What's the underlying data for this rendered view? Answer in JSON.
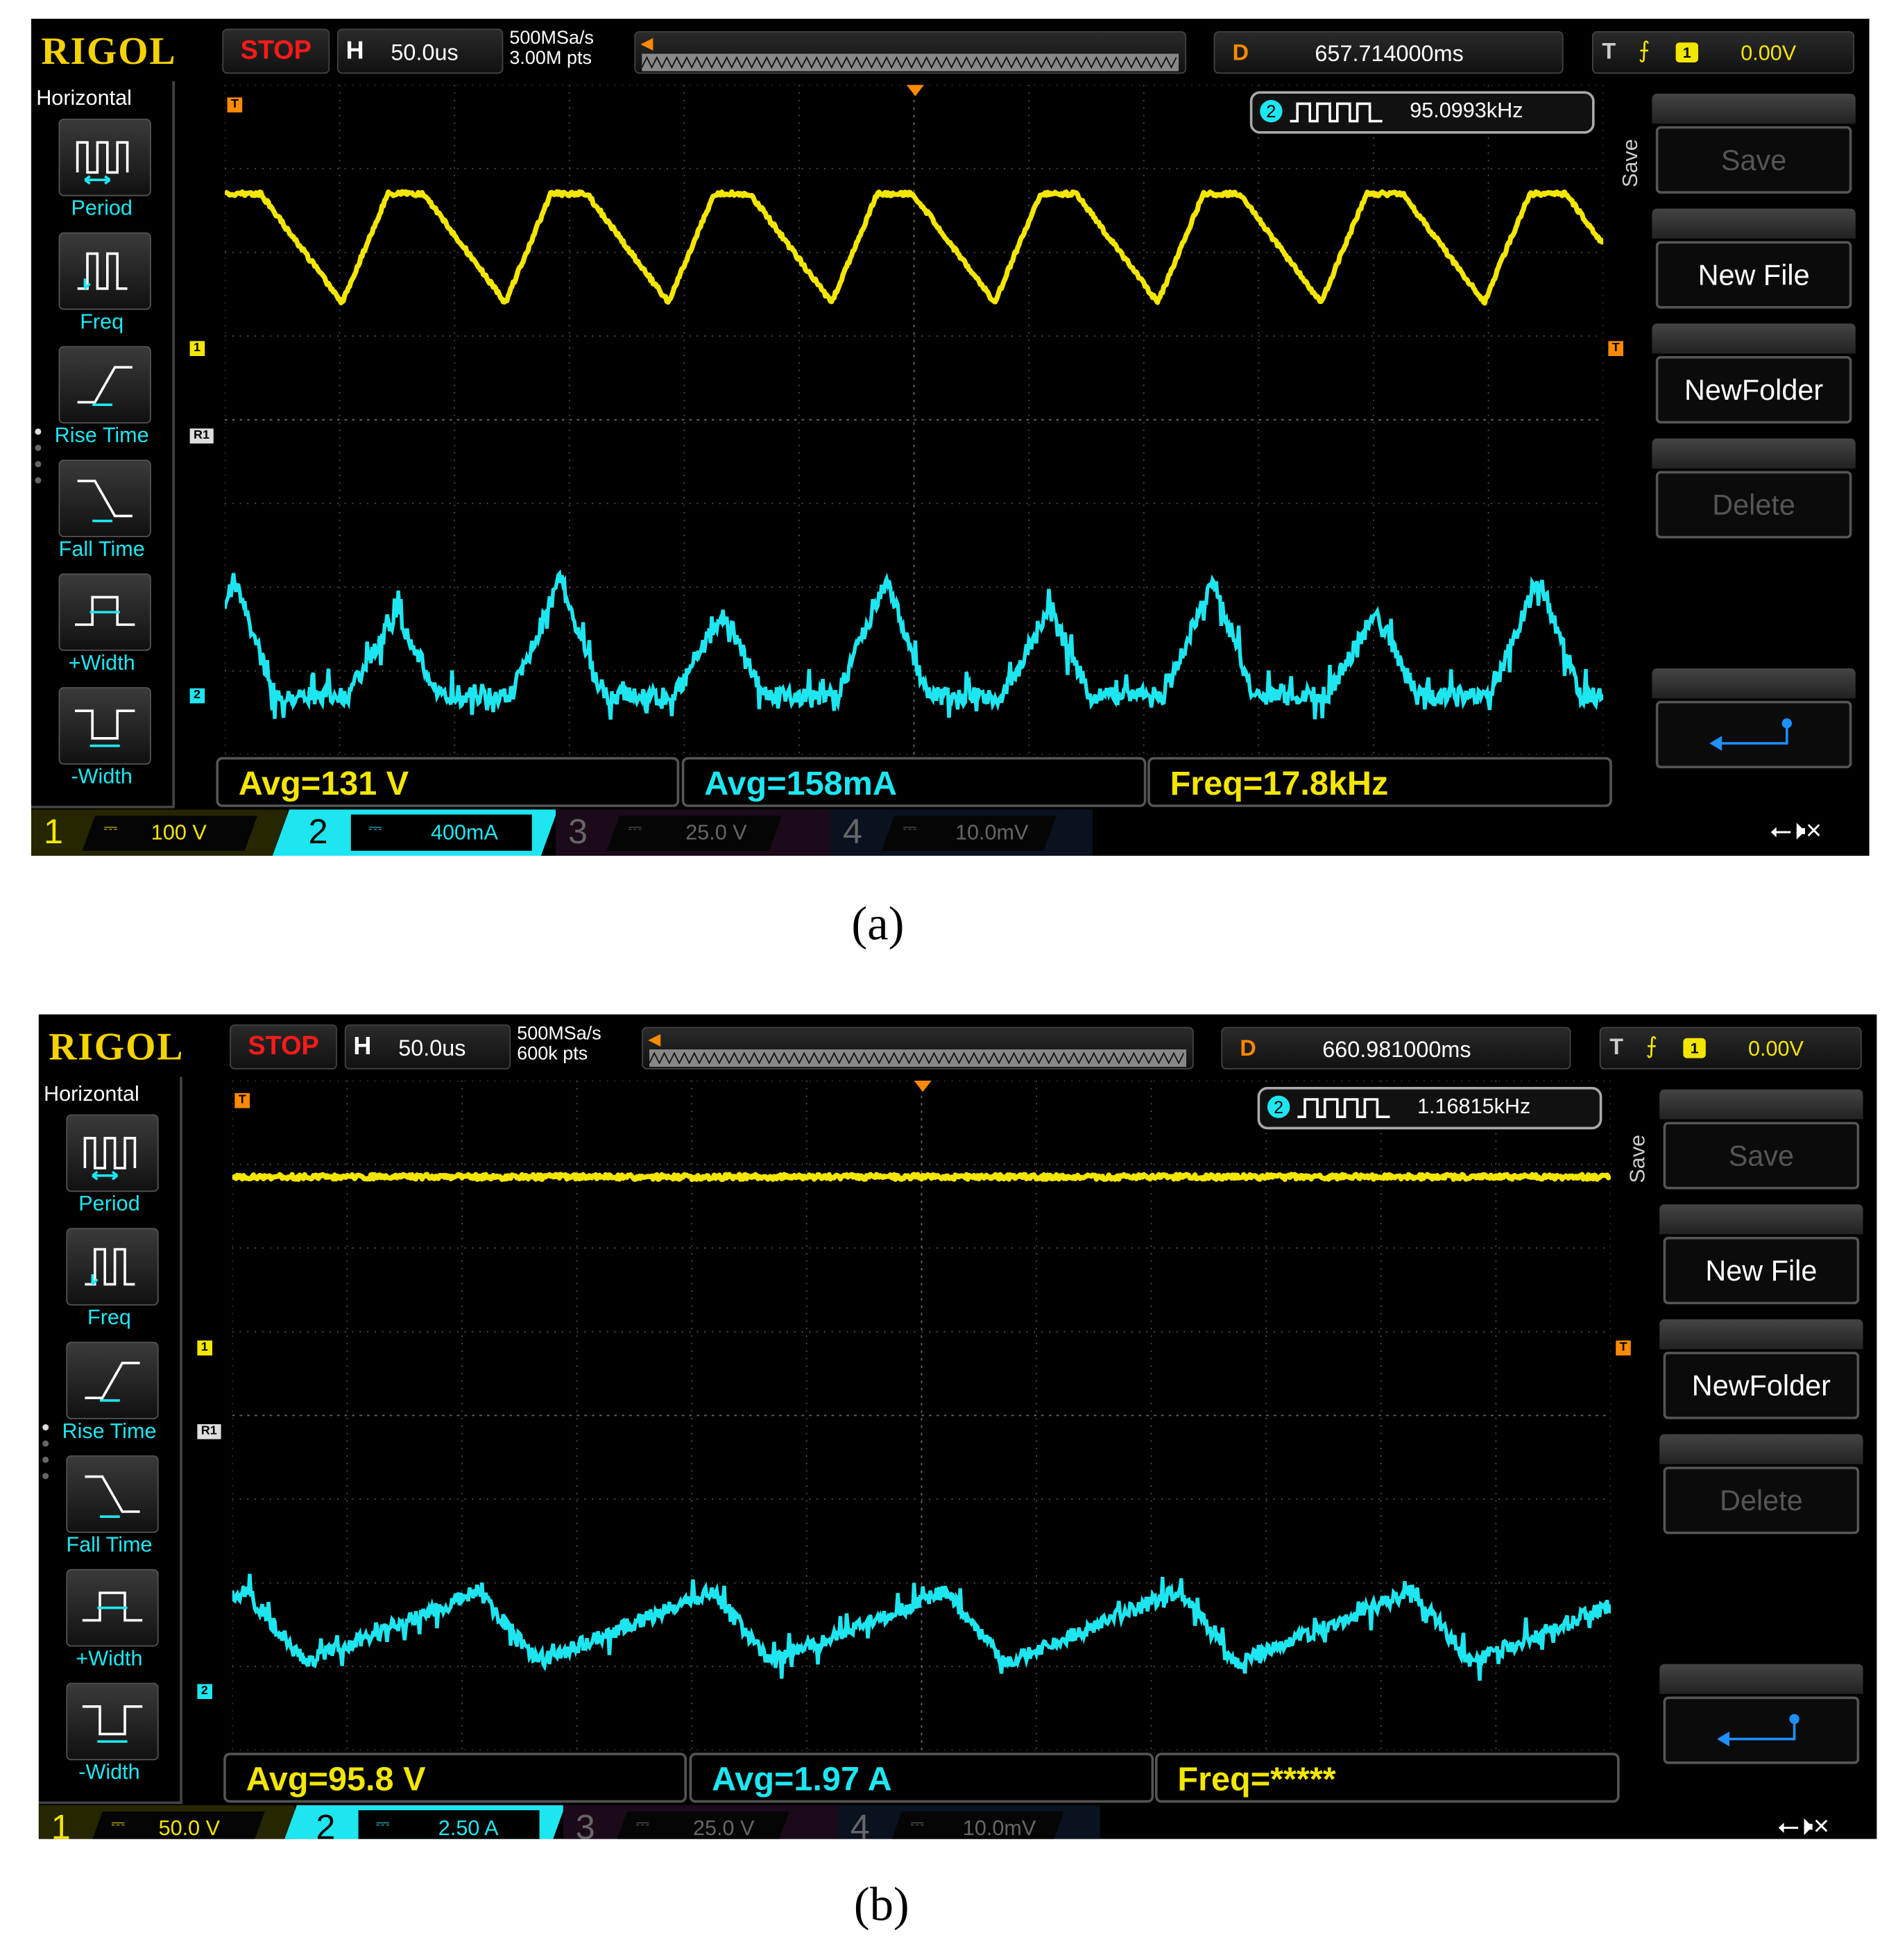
{
  "figure": {
    "captions": [
      "(a)",
      "(b)"
    ]
  },
  "panels": [
    {
      "logo": "RIGOL",
      "run_state": "STOP",
      "horizontal": {
        "key": "H",
        "timebase": "50.0us"
      },
      "sample_rate": "500MSa/s",
      "memory_depth": "3.00M pts",
      "delay": {
        "key": "D",
        "value": "657.714000ms"
      },
      "trigger": {
        "key": "T",
        "edge_icon": "rising-edge-icon",
        "source": "1",
        "level": "0.00V"
      },
      "sidebar": {
        "title": "Horizontal",
        "items": [
          "Period",
          "Freq",
          "Rise Time",
          "Fall Time",
          "+Width",
          "-Width"
        ]
      },
      "counter": {
        "channel": "2",
        "value": "95.0993kHz"
      },
      "markers": {
        "trig": "T",
        "ch1": "1",
        "ref": "R1",
        "ch2": "2"
      },
      "save_menu": {
        "title": "Save",
        "buttons": [
          "Save",
          "New File",
          "NewFolder",
          "Delete"
        ],
        "return_icon": "return-arrow-icon",
        "enabled": [
          false,
          true,
          true,
          false
        ]
      },
      "measurements": [
        {
          "text": "Avg=131 V",
          "color": "#f3e600"
        },
        {
          "text": "Avg=158mA",
          "color": "#1ee6f0"
        },
        {
          "text": "Freq=17.8kHz",
          "color": "#f3e600"
        }
      ],
      "channels": [
        {
          "num": "1",
          "coupling": "⎓",
          "scale": "100 V"
        },
        {
          "num": "2",
          "coupling": "⎓",
          "scale": "400mA"
        },
        {
          "num": "3",
          "coupling": "⎓",
          "scale": "25.0 V"
        },
        {
          "num": "4",
          "coupling": "⎓",
          "scale": "10.0mV"
        }
      ],
      "status_icons": [
        "usb-icon",
        "speaker-mute-icon"
      ],
      "waveforms": {
        "ch1": {
          "shape": "trapezoid-sawtooth",
          "period_div": 1.42,
          "high_div": 1.3,
          "low_div": 2.6
        },
        "ch2": {
          "shape": "alternating-triangle-pulses",
          "period_div": 1.42,
          "base_div": 7.3,
          "peak_div": [
            5.9,
            6.3
          ]
        },
        "marker_div": {
          "ch1": 3.15,
          "ref": 4.2,
          "ch2": 7.3,
          "trig": 3.15
        }
      }
    },
    {
      "logo": "RIGOL",
      "run_state": "STOP",
      "horizontal": {
        "key": "H",
        "timebase": "50.0us"
      },
      "sample_rate": "500MSa/s",
      "memory_depth": "600k pts",
      "delay": {
        "key": "D",
        "value": "660.981000ms"
      },
      "trigger": {
        "key": "T",
        "edge_icon": "rising-edge-icon",
        "source": "1",
        "level": "0.00V"
      },
      "sidebar": {
        "title": "Horizontal",
        "items": [
          "Period",
          "Freq",
          "Rise Time",
          "Fall Time",
          "+Width",
          "-Width"
        ]
      },
      "counter": {
        "channel": "2",
        "value": "1.16815kHz"
      },
      "markers": {
        "trig": "T",
        "ch1": "1",
        "ref": "R1",
        "ch2": "2"
      },
      "save_menu": {
        "title": "Save",
        "buttons": [
          "Save",
          "New File",
          "NewFolder",
          "Delete"
        ],
        "return_icon": "return-arrow-icon",
        "enabled": [
          false,
          true,
          true,
          false
        ]
      },
      "measurements": [
        {
          "text": "Avg=95.8 V",
          "color": "#f3e600"
        },
        {
          "text": "Avg=1.97 A",
          "color": "#1ee6f0"
        },
        {
          "text": "Freq=*****",
          "color": "#f3e600"
        }
      ],
      "channels": [
        {
          "num": "1",
          "coupling": "⎓",
          "scale": "50.0 V"
        },
        {
          "num": "2",
          "coupling": "⎓",
          "scale": "2.50 A"
        },
        {
          "num": "3",
          "coupling": "⎓",
          "scale": "25.0 V"
        },
        {
          "num": "4",
          "coupling": "⎓",
          "scale": "10.0mV"
        }
      ],
      "status_icons": [
        "usb-icon",
        "speaker-mute-icon"
      ],
      "waveforms": {
        "ch1": {
          "shape": "flat",
          "level_div": 1.15
        },
        "ch2": {
          "shape": "sawtooth",
          "period_div": 2.03,
          "min_div": 6.95,
          "max_div": 6.1,
          "rise_fraction": 0.75,
          "phase_div": 1.4
        },
        "marker_div": {
          "ch1": 3.2,
          "ref": 4.2,
          "ch2": 7.3,
          "trig": 3.2
        }
      }
    }
  ]
}
